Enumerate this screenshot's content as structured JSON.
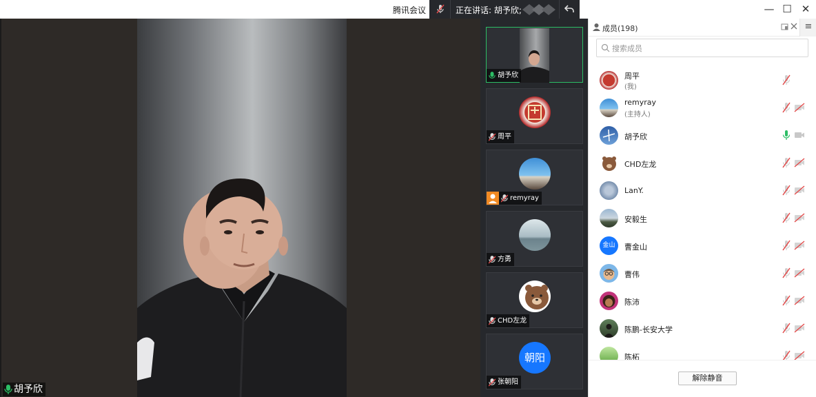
{
  "titlebar": {
    "app_title": "腾讯会议",
    "speaking_text": "正在讲话: 胡予欣;",
    "minimize": "—",
    "maximize": "☐",
    "close": "✕"
  },
  "stage": {
    "speaker_name": "胡予欣"
  },
  "thumbnails": [
    {
      "name": "胡予欣",
      "muted": false,
      "active": true
    },
    {
      "name": "周平",
      "muted": true,
      "active": false
    },
    {
      "name": "remyray",
      "muted": true,
      "active": false,
      "host": true
    },
    {
      "name": "方勇",
      "muted": true,
      "active": false
    },
    {
      "name": "CHD左龙",
      "muted": true,
      "active": false
    },
    {
      "name": "张朝阳",
      "muted": true,
      "active": false,
      "avatar_text": "朝阳"
    }
  ],
  "members_panel": {
    "title": "成员(198)",
    "search_placeholder": "搜索成员",
    "unmute_all_label": "解除静音",
    "members": [
      {
        "name": "周平",
        "role": "(我)",
        "mic": "muted",
        "camera": "none"
      },
      {
        "name": "remyray",
        "role": "(主持人)",
        "mic": "muted",
        "camera": "off"
      },
      {
        "name": "胡予欣",
        "role": "",
        "mic": "on",
        "camera": "off-gray"
      },
      {
        "name": "CHD左龙",
        "role": "",
        "mic": "muted",
        "camera": "off"
      },
      {
        "name": "LanY.",
        "role": "",
        "mic": "muted",
        "camera": "off"
      },
      {
        "name": "安毅生",
        "role": "",
        "mic": "muted",
        "camera": "off"
      },
      {
        "name": "曹金山",
        "role": "",
        "mic": "muted",
        "camera": "off",
        "avatar_text": "金山"
      },
      {
        "name": "曹伟",
        "role": "",
        "mic": "muted",
        "camera": "off"
      },
      {
        "name": "陈沛",
        "role": "",
        "mic": "muted",
        "camera": "off"
      },
      {
        "name": "陈鹏-长安大学",
        "role": "",
        "mic": "muted",
        "camera": "off"
      },
      {
        "name": "陈柘",
        "role": "",
        "mic": "muted",
        "camera": "off"
      }
    ]
  },
  "colors": {
    "accent_green": "#2cbe65",
    "mute_red": "#e34a4a",
    "host_orange": "#f08a24",
    "avatar_blue": "#1677ff"
  }
}
